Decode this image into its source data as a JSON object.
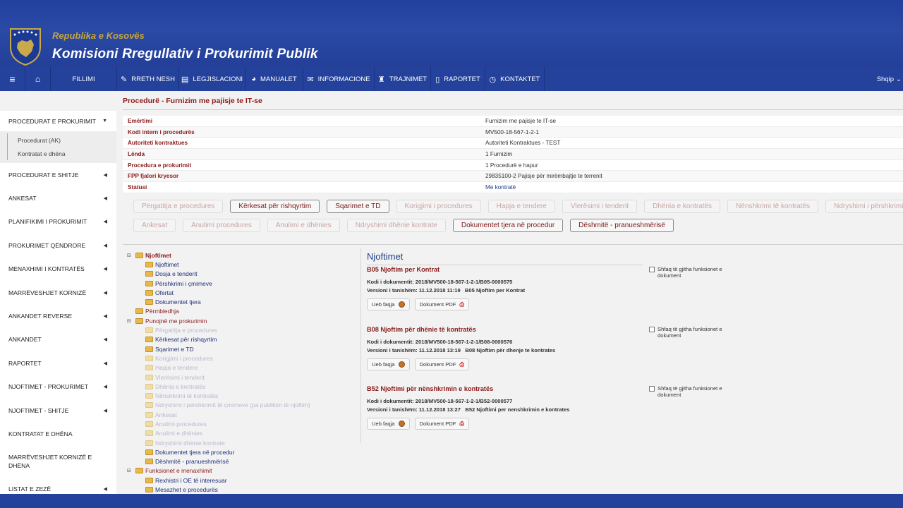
{
  "header": {
    "republic": "Republika e Kosovës",
    "agency": "Komisioni Rregullativ i Prokurimit Publik"
  },
  "nav": {
    "fillimi": "FILLIMI",
    "items": [
      {
        "label": "RRETH NESH",
        "icon": "edit-icon"
      },
      {
        "label": "LEGJISLACIONI",
        "icon": "book-icon"
      },
      {
        "label": "MANUALET",
        "icon": "dashboard-icon"
      },
      {
        "label": "INFORMACIONE",
        "icon": "envelope-icon"
      },
      {
        "label": "TRAJNIMET",
        "icon": "trophy-icon"
      },
      {
        "label": "RAPORTET",
        "icon": "file-icon"
      },
      {
        "label": "KONTAKTET",
        "icon": "clock-icon"
      }
    ],
    "lang": "Shqip"
  },
  "sidebar": {
    "open_group": "PROCEDURAT E PROKURIMIT",
    "sub": [
      "Procedurat (AK)",
      "Kontratat e dhëna"
    ],
    "items": [
      "PROCEDURAT E SHITJE",
      "ANKESAT",
      "PLANIFIKIMI I PROKURIMIT",
      "PROKURIMET QËNDRORE",
      "MENAXHIMI I KONTRATËS",
      "MARRËVESHJET KORNIZË",
      "ANKANDET REVERSE",
      "ANKANDET",
      "RAPORTET",
      "NJOFTIMET - PROKURIMET",
      "NJOFTIMET - SHITJE",
      "KONTRATAT E DHËNA",
      "MARRËVESHJET KORNIZË   E DHËNA",
      "LISTAT E ZEZË"
    ]
  },
  "page_title": "Procedurë - Furnizim me pajisje te IT-se",
  "info": [
    {
      "label": "Emërtimi",
      "value": "Furnizim me pajisje te IT-se"
    },
    {
      "label": "Kodi intern i procedurës",
      "value": "MV500-18-567-1-2-1"
    },
    {
      "label": "Autoriteti kontraktues",
      "value": "Autoriteti Kontraktues - TEST"
    },
    {
      "label": "Lënda",
      "value": "1 Furnizim"
    },
    {
      "label": "Procedura e prokurimit",
      "value": "1 Procedurë e hapur"
    },
    {
      "label": "FPP fjalori kryesor",
      "value": "29835100-2 Pajisje për mirëmbajtje te terrenit"
    },
    {
      "label": "Statusi",
      "value": "Me kontratë"
    }
  ],
  "steps_row1": [
    {
      "label": "Përgatitja e procedures",
      "active": false
    },
    {
      "label": "Kërkesat për rishqyrtim",
      "active": true
    },
    {
      "label": "Sqarimet e TD",
      "active": true
    },
    {
      "label": "Korigjimi i procedures",
      "active": false
    },
    {
      "label": "Hapja e tendere",
      "active": false
    },
    {
      "label": "Vlerësimi i tenderit",
      "active": false
    },
    {
      "label": "Dhënia e kontratës",
      "active": false
    },
    {
      "label": "Nënshkrimi të kontratës",
      "active": false
    },
    {
      "label": "Ndryshimi i përshkrimit",
      "active": false
    }
  ],
  "steps_row2": [
    {
      "label": "Ankesat",
      "active": false
    },
    {
      "label": "Anulimi procedures",
      "active": false
    },
    {
      "label": "Anulimi e dhënies",
      "active": false
    },
    {
      "label": "Ndryshimi dhënie kontrate",
      "active": false
    },
    {
      "label": "Dokumentet tjera në procedur",
      "active": true
    },
    {
      "label": "Dëshmitë - pranueshmërisë",
      "active": true
    }
  ],
  "tree": {
    "root": "Njoftimet",
    "root_children": [
      "Njoftimet",
      "Dosja e tenderit",
      "Përshkrimi i çmimeve",
      "Ofertat",
      "Dokumentet tjera"
    ],
    "permbledhja": "Përmbledhja",
    "punojne": "Punojnë me prokurimin",
    "punojne_children": [
      {
        "label": "Përgatitja e procedures",
        "dim": true
      },
      {
        "label": "Kërkesat për rishqyrtim",
        "dim": false
      },
      {
        "label": "Sqarimet e TD",
        "dim": false
      },
      {
        "label": "Korigjimi i procedures",
        "dim": true
      },
      {
        "label": "Hapja e tendere",
        "dim": true
      },
      {
        "label": "Vlerësimi i tenderit",
        "dim": true
      },
      {
        "label": "Dhënia e kontratës",
        "dim": true
      },
      {
        "label": "Nënshkrimi të kontratës",
        "dim": true
      },
      {
        "label": "Ndryshimi i përshkrimit të çmimeve (pa publikim të njoftim)",
        "dim": true
      },
      {
        "label": "Ankesat",
        "dim": true
      },
      {
        "label": "Anulimi procedures",
        "dim": true
      },
      {
        "label": "Anulimi e dhënies",
        "dim": true
      },
      {
        "label": "Ndryshimi dhënie kontrate",
        "dim": true
      },
      {
        "label": "Dokumentet tjera në procedur",
        "dim": false
      },
      {
        "label": "Dëshmitë - pranueshmërisë",
        "dim": false
      }
    ],
    "funksionet": "Funksionet e menaxhimit",
    "funksionet_children": [
      "Rexhistri i OE të interesuar",
      "Mesazhet e procedurës"
    ]
  },
  "notifs": {
    "title": "Njoftimet",
    "web_label": "Ueb faqja",
    "pdf_label": "Dokument PDF",
    "show_all": "Shfaq të gjitha funksionet e dokument",
    "items": [
      {
        "title": "B05 Njoftim per Kontrat",
        "code_label": "Kodi i dokumentit:",
        "code": "2018/MV500-18-567-1-2-1/B05-0000575",
        "ver_label": "Versioni i tanishëm:",
        "ver": "11.12.2018 11:19",
        "ver_name": "B05 Njoftim per Kontrat"
      },
      {
        "title": "B08 Njoftim për dhënie të kontratës",
        "code_label": "Kodi i dokumentit:",
        "code": "2018/MV500-18-567-1-2-1/B08-0000576",
        "ver_label": "Versioni i tanishëm:",
        "ver": "11.12.2018 13:19",
        "ver_name": "B08 Njoftim për dhenje te kontrates"
      },
      {
        "title": "B52 Njoftimi për nënshkrimin e kontratës",
        "code_label": "Kodi i dokumentit:",
        "code": "2018/MV500-18-567-1-2-1/B52-0000577",
        "ver_label": "Versioni i tanishëm:",
        "ver": "11.12.2018 13:27",
        "ver_name": "B52 Njoftimi per nenshkrimin e kontrates"
      }
    ]
  }
}
